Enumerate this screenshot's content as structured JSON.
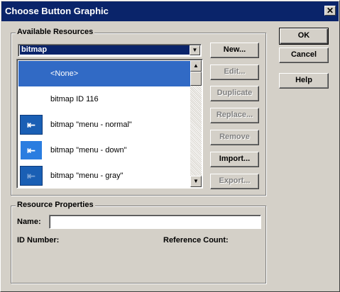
{
  "window": {
    "title": "Choose Button Graphic",
    "close_glyph": "✕"
  },
  "available_resources": {
    "group_label": "Available Resources",
    "combo_value": "bitmap",
    "combo_arrow": "▼",
    "list": [
      {
        "label": "<None>",
        "icon": null,
        "selected": true
      },
      {
        "label": "bitmap ID 116",
        "icon": null,
        "selected": false
      },
      {
        "label": "bitmap \"menu - normal\"",
        "icon": "arrow-left-icon",
        "selected": false
      },
      {
        "label": "bitmap \"menu - down\"",
        "icon": "arrow-left-icon",
        "selected": false
      },
      {
        "label": "bitmap \"menu - gray\"",
        "icon": "arrow-left-icon",
        "selected": false
      }
    ],
    "scroll_up": "▲",
    "scroll_down": "▼"
  },
  "side_buttons": {
    "new": "New...",
    "edit": "Edit...",
    "duplicate": "Duplicate",
    "replace": "Replace...",
    "remove": "Remove",
    "import": "Import...",
    "export": "Export..."
  },
  "dialog_buttons": {
    "ok": "OK",
    "cancel": "Cancel",
    "help": "Help"
  },
  "resource_properties": {
    "group_label": "Resource Properties",
    "name_label": "Name:",
    "name_value": "",
    "id_label": "ID Number:",
    "refcount_label": "Reference Count:"
  },
  "icon_glyph": "⇤"
}
